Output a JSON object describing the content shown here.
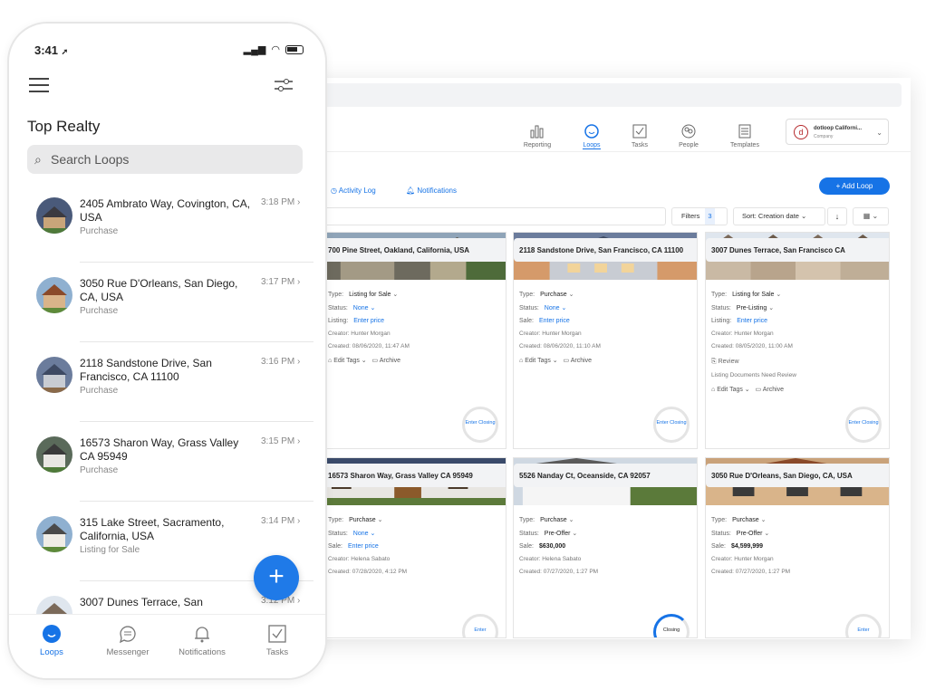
{
  "desktop": {
    "nav": [
      {
        "label": "Reporting",
        "icon": "bar-chart-icon"
      },
      {
        "label": "Loops",
        "icon": "loops-icon"
      },
      {
        "label": "Tasks",
        "icon": "checkbox-icon"
      },
      {
        "label": "People",
        "icon": "people-icon"
      },
      {
        "label": "Templates",
        "icon": "templates-icon"
      }
    ],
    "company": {
      "name": "dotloop Californi...",
      "sub": "Company",
      "logo_letter": "d"
    },
    "subnav": {
      "activity": "Activity Log",
      "notifications": "Notifications"
    },
    "add_loop": "+ Add Loop",
    "filters": {
      "label": "Filters",
      "count": "3"
    },
    "sort": "Sort: Creation date",
    "cards": [
      {
        "address": "700 Pine Street, Oakland, California, USA",
        "type": "Listing for Sale",
        "status": "None",
        "price_label": "Listing:",
        "price": "Enter price",
        "creator": "Creator: Hunter Morgan",
        "created": "Created: 08/06/2020, 11:47 AM",
        "ring": "Enter Closing"
      },
      {
        "address": "2118 Sandstone Drive, San Francisco, CA 11100",
        "type": "Purchase",
        "status": "None",
        "price_label": "Sale:",
        "price": "Enter price",
        "creator": "Creator: Hunter Morgan",
        "created": "Created: 08/06/2020, 11:10 AM",
        "ring": "Enter Closing"
      },
      {
        "address": "3007 Dunes Terrace, San Francisco CA",
        "type": "Listing for Sale",
        "status": "Pre-Listing",
        "price_label": "Listing:",
        "price": "Enter price",
        "creator": "Creator: Hunter Morgan",
        "created": "Created: 08/05/2020, 11:00 AM",
        "review": "Review",
        "review_note": "Listing Documents Need Review",
        "ring": "Enter Closing"
      },
      {
        "address": "16573 Sharon Way, Grass Valley CA 95949",
        "type": "Purchase",
        "status": "None",
        "price_label": "Sale:",
        "price": "Enter price",
        "creator": "Creator: Helena Sabato",
        "created": "Created: 07/28/2020, 4:12 PM",
        "ring": "Enter"
      },
      {
        "address": "5526 Nanday Ct, Oceanside, CA 92057",
        "type": "Purchase",
        "status": "Pre-Offer",
        "price_label": "Sale:",
        "price": "$630,000",
        "creator": "Creator: Helena Sabato",
        "created": "Created: 07/27/2020, 1:27 PM",
        "ring": "Closing"
      },
      {
        "address": "3050 Rue D'Orleans, San Diego, CA, USA",
        "type": "Purchase",
        "status": "Pre-Offer",
        "price_label": "Sale:",
        "price": "$4,599,999",
        "creator": "Creator: Hunter Morgan",
        "created": "Created: 07/27/2020, 1:27 PM",
        "ring": "Enter"
      }
    ],
    "labels": {
      "type": "Type:",
      "status": "Status:",
      "edit_tags": "Edit Tags",
      "archive": "Archive"
    }
  },
  "phone": {
    "time": "3:41",
    "title": "Top Realty",
    "search_placeholder": "Search Loops",
    "items": [
      {
        "title": "2405 Ambrato Way, Covington, CA, USA",
        "subtitle": "Purchase",
        "time": "3:18 PM"
      },
      {
        "title": "3050 Rue D'Orleans, San Diego, CA, USA",
        "subtitle": "Purchase",
        "time": "3:17 PM"
      },
      {
        "title": "2118 Sandstone Drive, San Francisco, CA 11100",
        "subtitle": "Purchase",
        "time": "3:16 PM"
      },
      {
        "title": "16573 Sharon Way, Grass Valley CA 95949",
        "subtitle": "Purchase",
        "time": "3:15 PM"
      },
      {
        "title": "315 Lake Street, Sacramento, California, USA",
        "subtitle": "Listing for Sale",
        "time": "3:14 PM"
      },
      {
        "title": "3007 Dunes Terrace, San",
        "subtitle": "",
        "time": "3:12 PM"
      }
    ],
    "tabs": [
      "Loops",
      "Messenger",
      "Notifications",
      "Tasks"
    ]
  },
  "colors": {
    "accent": "#1673e6",
    "fab": "#1f7ae8"
  }
}
